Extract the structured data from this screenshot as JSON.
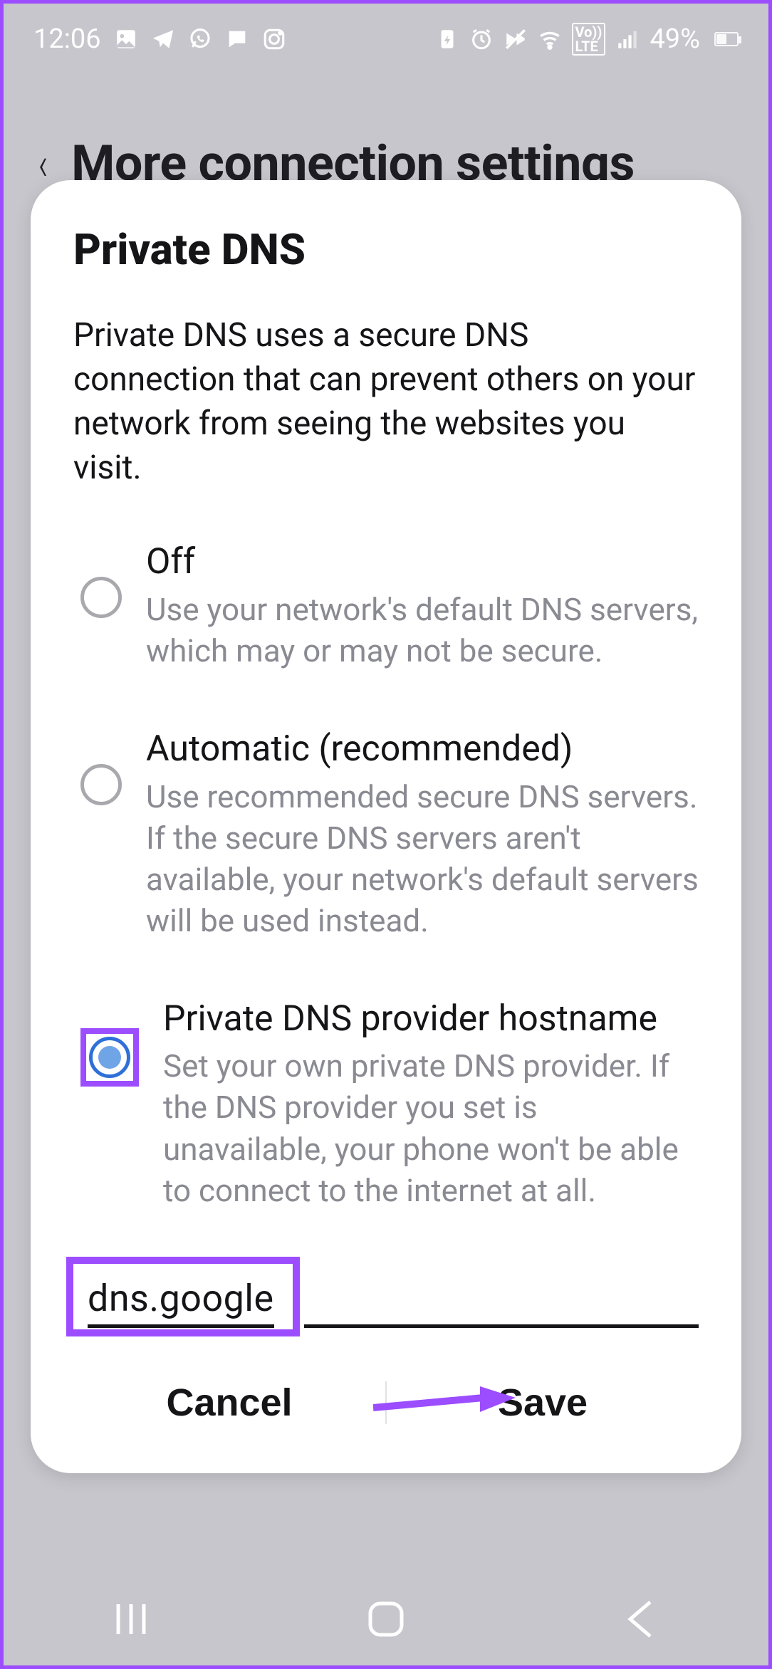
{
  "statusbar": {
    "time": "12:06",
    "battery_label": "49%"
  },
  "background_page": {
    "title": "More connection settings"
  },
  "dialog": {
    "title": "Private DNS",
    "description": "Private DNS uses a secure DNS connection that can prevent others on your network from seeing the websites you visit.",
    "options": [
      {
        "title": "Off",
        "subtitle": "Use your network's default DNS servers, which may or may not be secure.",
        "selected": false
      },
      {
        "title": "Automatic (recommended)",
        "subtitle": "Use recommended secure DNS servers. If the secure DNS servers aren't available, your network's default servers will be used instead.",
        "selected": false
      },
      {
        "title": "Private DNS provider hostname",
        "subtitle": "Set your own private DNS provider. If the DNS provider you set is unavailable, your phone won't be able to connect to the internet at all.",
        "selected": true
      }
    ],
    "hostname_value": "dns.google",
    "cancel_label": "Cancel",
    "save_label": "Save"
  },
  "annotations": {
    "highlight_color": "#9b4dff",
    "arrow_target": "save-button"
  }
}
